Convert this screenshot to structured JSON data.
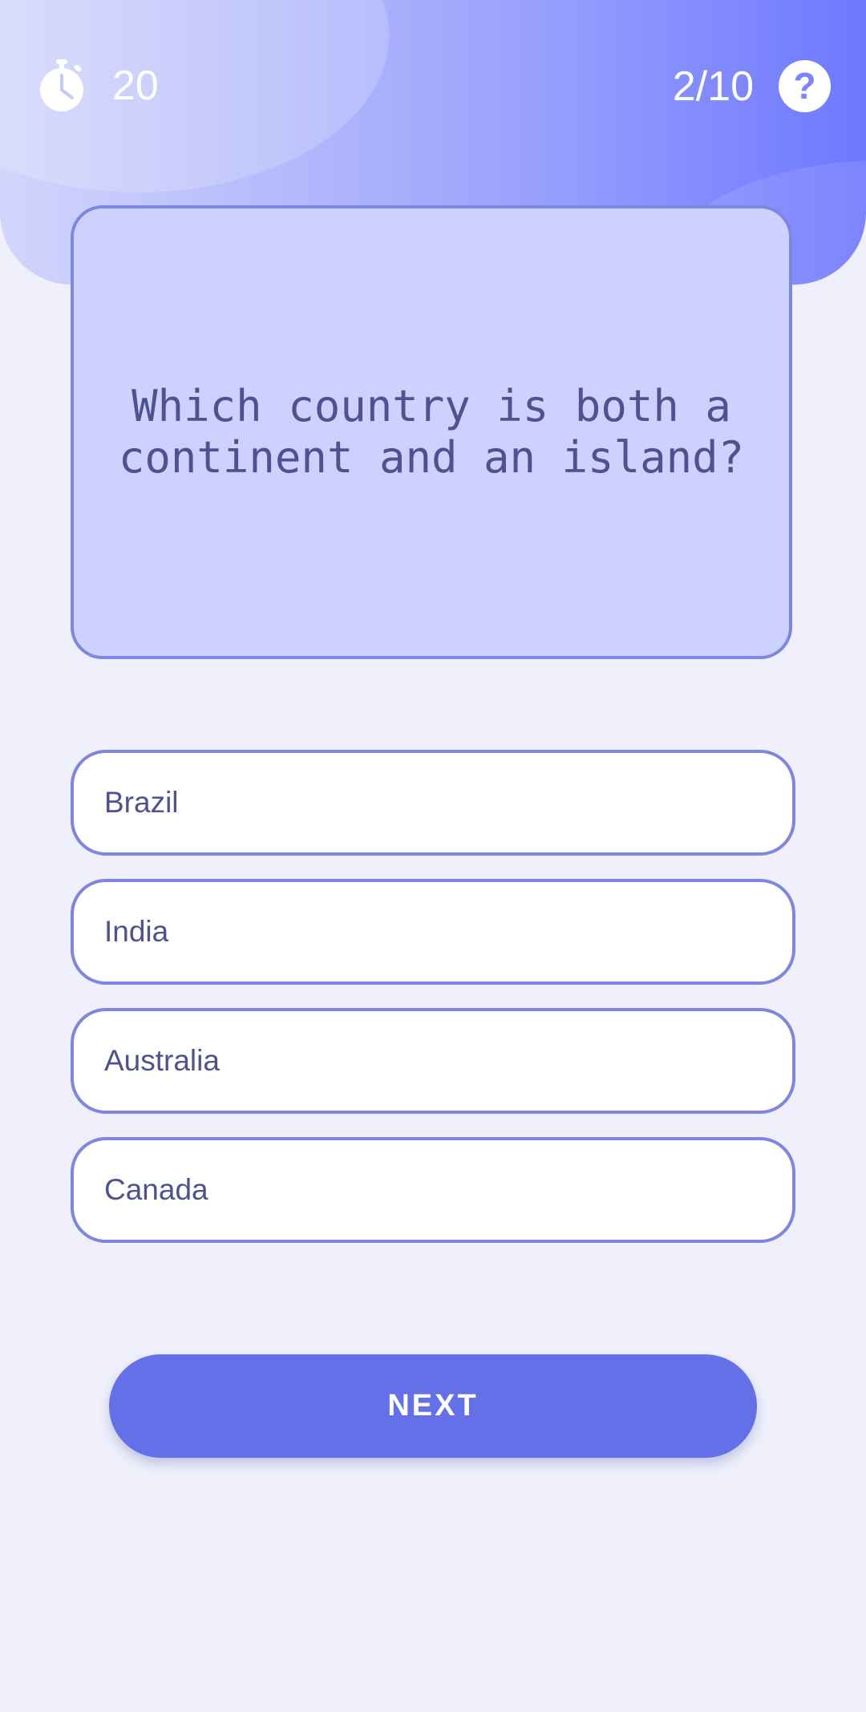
{
  "header": {
    "timer_value": "20",
    "timer_icon": "stopwatch-icon",
    "progress": "2/10",
    "help_icon": "question-mark-icon",
    "help_glyph": "?"
  },
  "question": {
    "text": "Which country is both a continent and an island?"
  },
  "options": [
    {
      "label": "Brazil"
    },
    {
      "label": "India"
    },
    {
      "label": "Australia"
    },
    {
      "label": "Canada"
    }
  ],
  "next_button": {
    "label": "NEXT"
  },
  "colors": {
    "accent": "#6370e8",
    "border": "#7d86e0",
    "card_background": "#cdd1fd",
    "text": "#4e5290",
    "page_background": "#eff0fb"
  }
}
